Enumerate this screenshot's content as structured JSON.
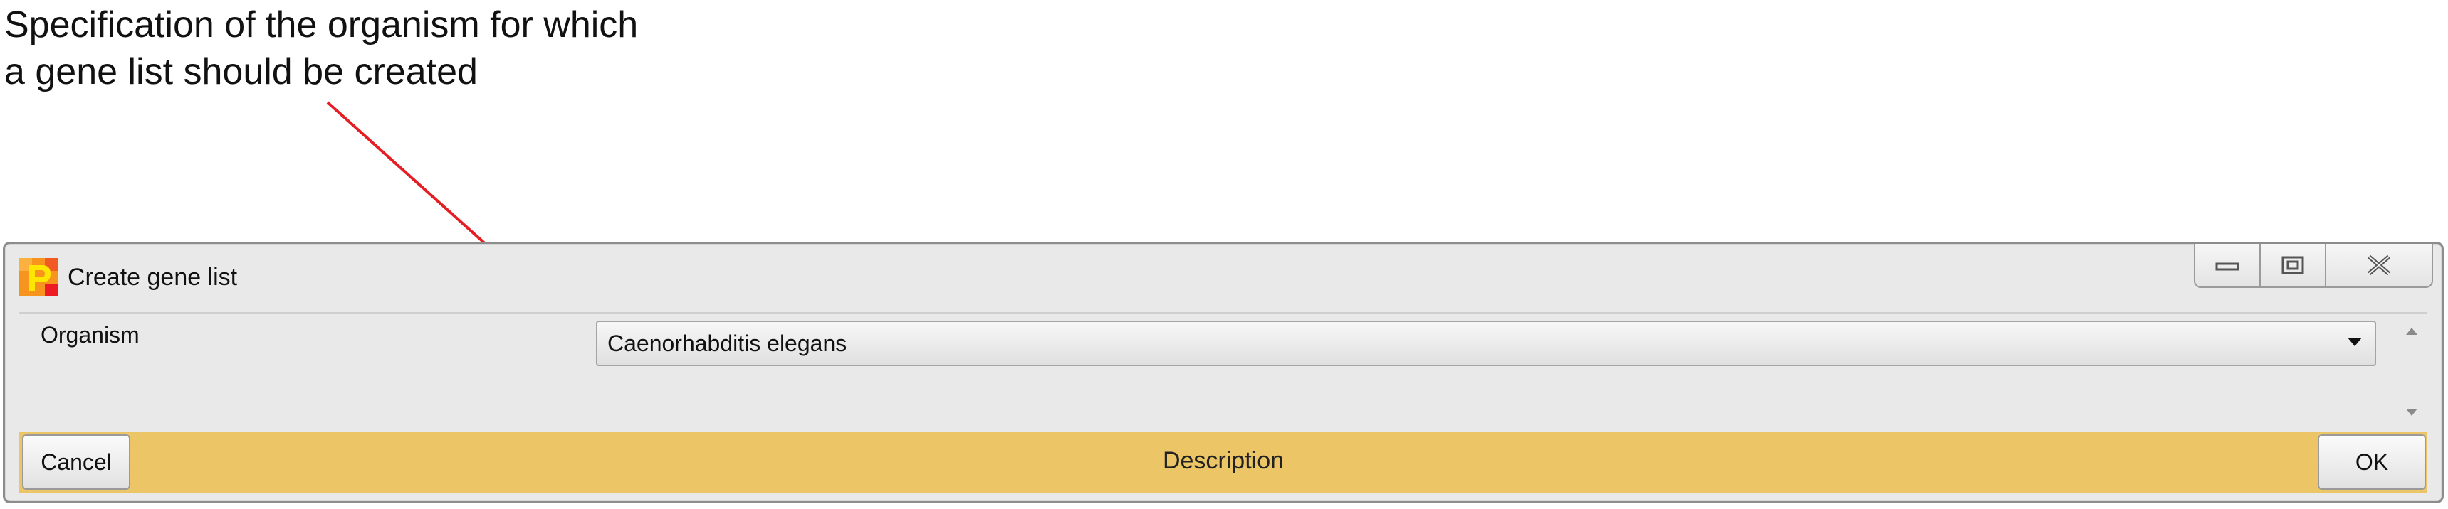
{
  "annotation": {
    "line1": "Specification of the organism for which",
    "line2": "a gene list should be created",
    "arrow_color": "#e31e24"
  },
  "window": {
    "title": "Create gene list",
    "icon": "app-icon",
    "controls": {
      "minimize": "minimize-icon",
      "maximize": "maximize-icon",
      "close": "close-icon"
    }
  },
  "form": {
    "organism_label": "Organism",
    "organism_value": "Caenorhabditis elegans"
  },
  "footer": {
    "cancel_label": "Cancel",
    "description": "Description",
    "ok_label": "OK",
    "bar_color": "#ecc566"
  }
}
